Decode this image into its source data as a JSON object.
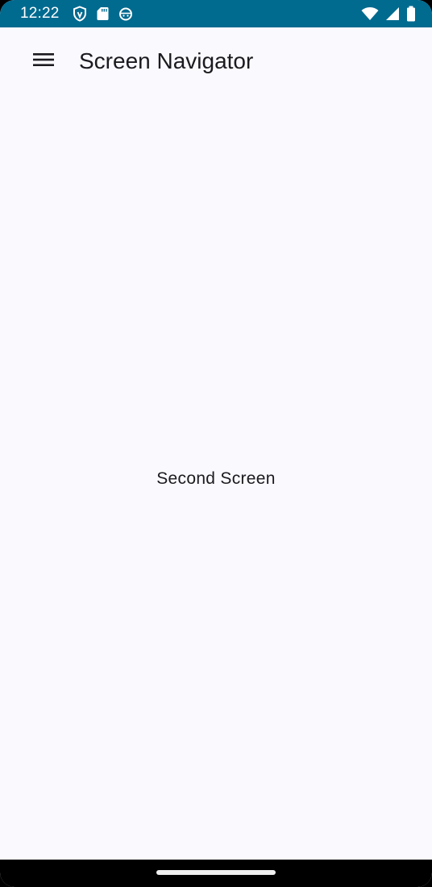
{
  "status_bar": {
    "time": "12:22",
    "left_icons": [
      "shield-icon",
      "sd-card-icon",
      "android-debug-icon"
    ],
    "right_icons": [
      "wifi-icon",
      "cell-signal-icon",
      "battery-icon"
    ],
    "background_color": "#006a8f"
  },
  "app_bar": {
    "menu_icon": "menu-icon",
    "title": "Screen Navigator"
  },
  "main": {
    "screen_label": "Second Screen",
    "background_color": "#faf9fd"
  }
}
